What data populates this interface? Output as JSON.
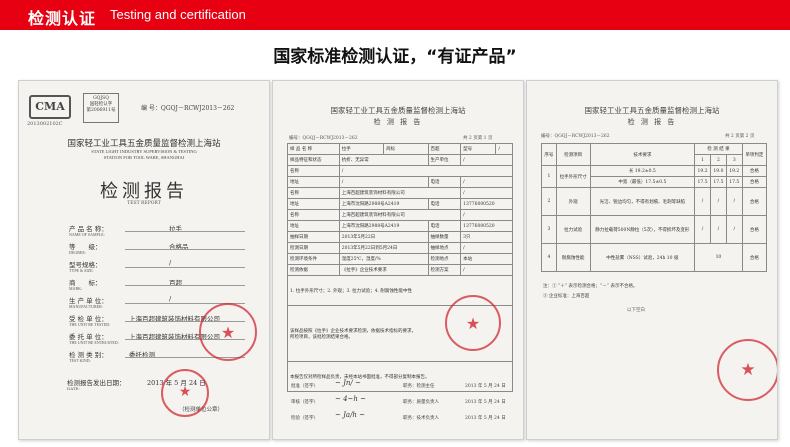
{
  "banner": {
    "title_cn": "检测认证",
    "title_en": "Testing and certification",
    "bg_color": "#e60012"
  },
  "heading": "国家标准检测认证，“有证产品”",
  "doc1": {
    "ma_mark": "CMA",
    "ma_code": "2013002102C",
    "qbox_line1": "GQJSQ",
    "qbox_line2": "国轻检认字",
    "qbox_line3": "第2006911号",
    "serial": "编 号：QGQJ－RCWJ2013－262",
    "title_cn": "国家轻工业工具五金质量监督检测上海站",
    "title_en_1": "STATE LIGHT INDUSTRY SUPERVISION & TESTING",
    "title_en_2": "STATION FOR TOOL WARE, SHANGHAI",
    "report": "检测报告",
    "report_en": "TEST REPORT",
    "fields": [
      {
        "label": "产 品 名 称：",
        "en": "NAME OF SAMPLE:",
        "value": "拉手"
      },
      {
        "label": "等　　级：",
        "en": "DEGREE:",
        "value": "合格品"
      },
      {
        "label": "型号规格：",
        "en": "TYPE & SIZE:",
        "value": "/"
      },
      {
        "label": "商　　标：",
        "en": "MARK:",
        "value": "百超"
      },
      {
        "label": "生 产 单 位：",
        "en": "MANUFACTURER:",
        "value": "/"
      },
      {
        "label": "受 检 单 位：",
        "en": "THE UNIT BE TESTED:",
        "value": "上海百超建筑装饰材料有限公司"
      },
      {
        "label": "委 托 单 位：",
        "en": "THE UNIT BE ENTRUSTED:",
        "value": "上海百超建筑装饰材料有限公司"
      },
      {
        "label": "检 测 类 别：",
        "en": "TEST KIND:",
        "value": "委托检测"
      }
    ],
    "date_label": "检测报告发出日期：",
    "date_en": "DATE:",
    "date_value": "2013 年 5 月 24 日",
    "footer": "（检测单位公章）"
  },
  "doc2": {
    "title": "国家轻工业工具五金质量监督检测上海站",
    "subtitle": "检 测 报 告",
    "number": "编号：QGQJ－RCWJ2013－262",
    "page": "共 2 页第 1 页",
    "rows": [
      [
        "样 品 名 称",
        "拉手",
        "商标",
        "百超",
        "型号",
        "/"
      ],
      [
        "样品特征和状态",
        "抗折、无异常",
        "",
        "生产单位",
        "/",
        ""
      ],
      [
        "名称",
        "/",
        "",
        "",
        "",
        ""
      ],
      [
        "地址",
        "/",
        "",
        "电话",
        "/",
        ""
      ],
      [
        "名称",
        "上海百超建筑装饰材料有限公司",
        "",
        "",
        "/",
        ""
      ],
      [
        "地址",
        "上海市沈阳路2988号A2419",
        "",
        "电话",
        "13776000520",
        ""
      ],
      [
        "名称",
        "上海百超建筑装饰材料有限公司",
        "",
        "",
        "/",
        ""
      ],
      [
        "地址",
        "上海市沈阳路2988号A2419",
        "",
        "电话",
        "13776000520",
        ""
      ],
      [
        "抽样日期",
        "2013年5月22日",
        "抽样数量",
        "3只",
        "",
        ""
      ],
      [
        "检测日期",
        "2013年5月22日到5月24日",
        "抽样地点",
        "/",
        "",
        ""
      ],
      [
        "检测环境条件",
        "温度25℃，湿度/%",
        "检测地点",
        "本站",
        "",
        ""
      ],
      [
        "检测依据",
        "《拉手》企业技术要求",
        "检测方案",
        "/",
        "",
        ""
      ]
    ],
    "project": "1. 拉手外形尺寸；2. 外观；3. 拉力试验；4. 耐腐蚀性能中性",
    "conclusion_1": "该样品按照《拉手》企业技术要求检测，依据技术指标的要求，",
    "conclusion_2": "所检项目，该批检测结果合格。",
    "remark": "本报告仅对所检样品负责，未经本站书面批准，不得部分复制本报告。",
    "sign_1_label": "批准（签字）",
    "sign_1_role": "职务：检测主任",
    "sign_2_label": "审核（签字）",
    "sign_2_role": "职务：质量负责人",
    "sign_3_label": "检验（签字）",
    "sign_3_role": "职务：技术负责人",
    "sign_date": "2013 年 5 月 24 日"
  },
  "doc3": {
    "title": "国家轻工业工具五金质量监督检测上海站",
    "subtitle": "检 测 报 告",
    "number": "编号：QGQJ－RCWJ2013－262",
    "page": "共 2 页第 2 页",
    "header": [
      "序号",
      "检测项目",
      "技术要求",
      "检 测 结 果",
      "",
      "",
      "单项判定"
    ],
    "subheader": [
      "",
      "",
      "",
      "1",
      "2",
      "3",
      ""
    ],
    "rows": [
      [
        "1",
        "拉手外形尺寸",
        "长 19.2±0.5",
        "19.2",
        "19.0",
        "19.2",
        "合格"
      ],
      [
        "",
        "",
        "中宽（最低）17.5±0.5",
        "17.5",
        "17.5",
        "17.5",
        "合格"
      ],
      [
        "2",
        "外观",
        "光洁、锐边均匀，不得有划痕、毛刺等缺陷",
        "/",
        "/",
        "/",
        "合格"
      ],
      [
        "3",
        "拉力试验",
        "静力拉载荷500N静拉（5次），不得损坏及变形",
        "/",
        "/",
        "/",
        "合格"
      ],
      [
        "4",
        "耐腐蚀性能",
        "中性盐雾（NSS）试验，24h 10 级",
        "10",
        "",
        "",
        "合格"
      ]
    ],
    "note_1": "注：① “＋” 表示检测合格；“－” 表示不合格。",
    "note_2": "② 企业标准：上海百超",
    "end": "以下空白"
  }
}
